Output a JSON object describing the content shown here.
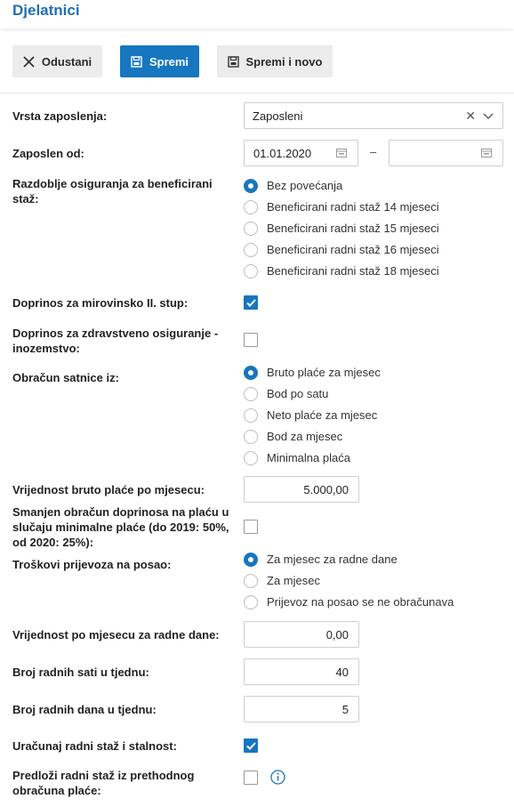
{
  "header": {
    "title": "Djelatnici"
  },
  "toolbar": {
    "cancel_label": "Odustani",
    "save_label": "Spremi",
    "save_new_label": "Spremi i novo"
  },
  "form": {
    "employment_type": {
      "label": "Vrsta zaposlenja:",
      "value": "Zaposleni"
    },
    "employed_from": {
      "label": "Zaposlen od:",
      "from": "01.01.2020",
      "to": "",
      "separator": "–"
    },
    "insurance_period": {
      "label_line1": "Razdoblje osiguranja za beneficirani",
      "label_line2": "staž:",
      "options": [
        "Bez povećanja",
        "Beneficirani radni staž 14 mjeseci",
        "Beneficirani radni staž 15 mjeseci",
        "Beneficirani radni staž 16 mjeseci",
        "Beneficirani radni staž 18 mjeseci"
      ],
      "selected": 0
    },
    "pension_pillar2": {
      "label": "Doprinos za mirovinsko II. stup:",
      "checked": true
    },
    "health_abroad": {
      "label_line1": "Doprinos za zdravstveno osiguranje -",
      "label_line2": "inozemstvo:",
      "checked": false
    },
    "hourly_rate_from": {
      "label": "Obračun satnice iz:",
      "options": [
        "Bruto plaće za mjesec",
        "Bod po satu",
        "Neto plaće za mjesec",
        "Bod za mjesec",
        "Minimalna plaća"
      ],
      "selected": 0
    },
    "gross_salary": {
      "label": "Vrijednost bruto plaće po mjesecu:",
      "value": "5.000,00"
    },
    "reduced_contrib": {
      "label_line1": "Smanjen obračun doprinosa na plaću u",
      "label_line2": "slučaju minimalne plaće (do 2019: 50%,",
      "label_line3": "od 2020: 25%):",
      "checked": false
    },
    "transport": {
      "label": "Troškovi prijevoza na posao:",
      "options": [
        "Za mjesec za radne dane",
        "Za mjesec",
        "Prijevoz na posao se ne obračunava"
      ],
      "selected": 0
    },
    "monthly_workdays_value": {
      "label": "Vrijednost po mjesecu za radne dane:",
      "value": "0,00"
    },
    "weekly_hours": {
      "label": "Broj radnih sati u tjednu:",
      "value": "40"
    },
    "weekly_days": {
      "label": "Broj radnih dana u tjednu:",
      "value": "5"
    },
    "include_tenure": {
      "label": "Uračunaj radni staž i stalnost:",
      "checked": true
    },
    "suggest_tenure": {
      "label_line1": "Predloži radni staž iz prethodnog",
      "label_line2": "obračuna plaće:",
      "checked": false
    }
  },
  "colors": {
    "accent": "#1676c0",
    "title": "#1f6fb5"
  }
}
